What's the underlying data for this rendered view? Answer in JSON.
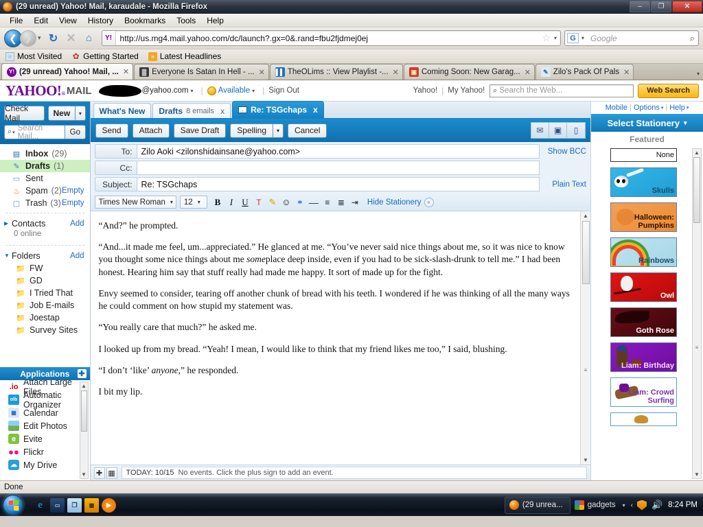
{
  "window": {
    "title": "(29 unread) Yahoo! Mail, karaudale - Mozilla Firefox",
    "firefox_icon": "firefox-icon",
    "minimize": "–",
    "maximize": "❐",
    "close": "✕"
  },
  "menubar": {
    "items": [
      "File",
      "Edit",
      "View",
      "History",
      "Bookmarks",
      "Tools",
      "Help"
    ]
  },
  "navbar": {
    "back_icon": "back-arrow-icon",
    "forward_icon": "forward-arrow-icon",
    "history_caret": "▾",
    "reload_icon": "↻",
    "stop_icon": "✕",
    "home_icon": "⌂",
    "favicon": "Y!",
    "url": "http://us.mg4.mail.yahoo.com/dc/launch?.gx=0&.rand=fbu2fjdmej0ej",
    "bookmark_star": "☆",
    "url_caret": "▾",
    "search_engine": "G",
    "search_engine_caret": "▾",
    "search_placeholder": "Google",
    "search_magnifier": "⌕"
  },
  "bookmarks": [
    {
      "label": "Most Visited",
      "icon": "most-visited-icon"
    },
    {
      "label": "Getting Started",
      "icon": "getting-started-icon"
    },
    {
      "label": "Latest Headlines",
      "icon": "rss-feed-icon"
    }
  ],
  "browser_tabs": [
    {
      "label": "(29 unread) Yahoo! Mail, ...",
      "favicon": "yahoo-favicon",
      "favicon_glyph": "Y!",
      "active": true,
      "close": "✕"
    },
    {
      "label": "Everyone Is Satan In Hell - ...",
      "favicon": "tv-favicon",
      "favicon_glyph": "▓",
      "active": false,
      "close": "✕"
    },
    {
      "label": "TheOLims :: View Playlist -...",
      "favicon": "playlist-favicon",
      "favicon_glyph": "▌▌",
      "active": false,
      "close": "✕"
    },
    {
      "label": "Coming Soon: New Garag...",
      "favicon": "garage-favicon",
      "favicon_glyph": "▣",
      "active": false,
      "close": "✕"
    },
    {
      "label": "Zilo's Pack Of Pals",
      "favicon": "pals-favicon",
      "favicon_glyph": "✎",
      "active": false,
      "close": "✕"
    }
  ],
  "tabstrip_overflow_caret": "▾",
  "yahoo_header": {
    "logo": "YAHOO!",
    "logo_reg": "®",
    "mail_word": "MAIL",
    "account_redacted": "redacted-username",
    "account_domain": "@yahoo.com",
    "account_caret": "▾",
    "status_icon": "smiley-icon",
    "status_label": "Available",
    "status_caret": "▾",
    "signout_label": "Sign Out",
    "nav_yahoo": "Yahoo!",
    "nav_myyahoo": "My Yahoo!",
    "web_search_placeholder": "Search the Web...",
    "web_search_magnifier": "⌕",
    "web_search_button": "Web Search"
  },
  "sidebar": {
    "check_mail_label": "Check Mail",
    "new_label": "New",
    "new_caret": "▾",
    "search_placeholder": "Search Mail...",
    "search_magnifier": "⌕",
    "search_caret": "▾",
    "go_label": "Go",
    "mail_folders": [
      {
        "label": "Inbox",
        "count": "(29)",
        "icon": "inbox-icon",
        "glyph": "▤",
        "action": "",
        "selected": false
      },
      {
        "label": "Drafts",
        "count": "(1)",
        "icon": "drafts-icon",
        "glyph": "✎",
        "action": "",
        "selected": true
      },
      {
        "label": "Sent",
        "count": "",
        "icon": "sent-icon",
        "glyph": "▭",
        "action": "",
        "selected": false
      },
      {
        "label": "Spam",
        "count": "(2)",
        "icon": "spam-flame-icon",
        "glyph": "🔥",
        "action": "Empty",
        "selected": false
      },
      {
        "label": "Trash",
        "count": "(3)",
        "icon": "trash-icon",
        "glyph": "🗑",
        "action": "Empty",
        "selected": false
      }
    ],
    "contacts": {
      "label": "Contacts",
      "add": "Add",
      "caret": "▶",
      "online": "0 online"
    },
    "folders": {
      "label": "Folders",
      "add": "Add",
      "caret": "▼"
    },
    "custom_folders": [
      {
        "label": "FW",
        "icon": "folder-icon"
      },
      {
        "label": "GD",
        "icon": "folder-icon"
      },
      {
        "label": "I Tried That",
        "icon": "folder-icon"
      },
      {
        "label": "Job E-mails",
        "icon": "folder-icon"
      },
      {
        "label": "Joestap",
        "icon": "folder-icon"
      },
      {
        "label": "Survey Sites",
        "icon": "folder-icon"
      }
    ],
    "applications": {
      "header": "Applications",
      "plus": "✚",
      "items": [
        {
          "label": "Attach Large Files",
          "icon": "io-icon",
          "glyph": ".io"
        },
        {
          "label": "Automatic Organizer",
          "icon": "olb-icon",
          "glyph": "olb"
        },
        {
          "label": "Calendar",
          "icon": "calendar-icon",
          "glyph": "▦"
        },
        {
          "label": "Edit Photos",
          "icon": "edit-photos-icon",
          "glyph": "▨"
        },
        {
          "label": "Evite",
          "icon": "evite-icon",
          "glyph": "e"
        },
        {
          "label": "Flickr",
          "icon": "flickr-icon",
          "glyph": "●●"
        },
        {
          "label": "My Drive",
          "icon": "my-drive-icon",
          "glyph": "☁"
        }
      ],
      "scroll_up": "▲",
      "scroll_down": "▼",
      "grip": "≡"
    }
  },
  "compose": {
    "tabs": [
      {
        "label": "What's New",
        "active": false,
        "closable": false
      },
      {
        "label": "Drafts",
        "sublabel": "8 emails",
        "active": false,
        "closable": true,
        "close": "x"
      },
      {
        "label": "Re: TSGchaps",
        "active": true,
        "closable": true,
        "close": "x",
        "icon": "envelope-icon"
      }
    ],
    "toolbar": {
      "send": "Send",
      "attach": "Attach",
      "save_draft": "Save Draft",
      "spelling": "Spelling",
      "spelling_caret": "▾",
      "cancel": "Cancel",
      "right_icons": [
        {
          "name": "email-notify-icon",
          "glyph": "✉"
        },
        {
          "name": "im-notify-icon",
          "glyph": "▣"
        },
        {
          "name": "mobile-text-icon",
          "glyph": "▯"
        }
      ]
    },
    "fields": {
      "to_label": "To:",
      "to_value": "Zilo Aoki <zilonshidainsane@yahoo.com>",
      "show_bcc": "Show BCC",
      "cc_label": "Cc:",
      "cc_value": "",
      "subject_label": "Subject:",
      "subject_value": "Re: TSGchaps",
      "plain_text": "Plain Text"
    },
    "format_toolbar": {
      "font_family": "Times New Roman",
      "font_size": "12",
      "caret": "▾",
      "bold": "B",
      "italic": "I",
      "underline": "U",
      "text_color_icon": "text-color-icon",
      "text_color_glyph": "T",
      "highlight_icon": "highlighter-icon",
      "highlight_glyph": "✎",
      "emoticon_icon": "emoticon-icon",
      "emoticon_glyph": "☺",
      "link_icon": "insert-link-icon",
      "link_glyph": "🔗",
      "hrule_icon": "horizontal-rule-icon",
      "hrule_glyph": "—",
      "align_icon": "align-icon",
      "align_glyph": "≡",
      "list_icon": "bullet-list-icon",
      "list_glyph": "⁝≡",
      "indent_icon": "indent-icon",
      "indent_glyph": "⇥",
      "hide_stationery": "Hide Stationery",
      "hide_stationery_glyph": "»"
    },
    "body_paragraphs": [
      {
        "text": "“And?” he prompted."
      },
      {
        "pre": "“And...it made me feel, um...appreciated.” He glanced at me. “You’ve never said nice things about me, so it was nice to know you thought some nice things about me ",
        "em": "some",
        "post": "place deep inside, even if you had to be sick-slash-drunk to tell me.” I had been honest. Hearing him say that stuff really had made me happy. It sort of made up for the fight."
      },
      {
        "text": "Envy seemed to consider, tearing off another chunk of bread with his teeth. I wondered if he was thinking of all the many ways he could comment on how stupid my statement was."
      },
      {
        "text": "“You really care that much?” he asked me."
      },
      {
        "text": "I looked up from my bread. “Yeah! I mean, I would like to think that my friend likes me too,” I said, blushing."
      },
      {
        "pre": "“I don’t ‘like’ ",
        "em": "anyone",
        "post": ",” he responded."
      },
      {
        "text": "I bit my lip."
      }
    ],
    "body_scroll": {
      "up": "▲",
      "down": "▼",
      "grip": "≡"
    },
    "calendar_bar": {
      "plus": "✚",
      "cal_icon": "calendar-grid-icon",
      "cal_glyph": "▦",
      "today_label": "TODAY: 10/15",
      "text": "No events. Click the plus sign to add an event."
    }
  },
  "stationery": {
    "top_links": {
      "mobile": "Mobile",
      "options": "Options",
      "options_caret": "▾",
      "help": "Help",
      "help_caret": "▾"
    },
    "header": "Select Stationery",
    "header_caret": "▾",
    "section": "Featured",
    "items": [
      {
        "label": "None",
        "kind": "none"
      },
      {
        "label": "Skulls",
        "kind": "skulls"
      },
      {
        "label": "Halloween: Pumpkins",
        "kind": "halloween"
      },
      {
        "label": "Rainbows",
        "kind": "rainbows"
      },
      {
        "label": "Owl",
        "kind": "owl"
      },
      {
        "label": "Goth Rose",
        "kind": "goth"
      },
      {
        "label": "Liam: Birthday",
        "kind": "liam"
      },
      {
        "label": "Liam: Crowd Surfing",
        "kind": "crowd"
      },
      {
        "label": "",
        "kind": "last"
      }
    ],
    "scroll": {
      "up": "▲",
      "down": "▼",
      "grip": "≡"
    }
  },
  "status_bar": {
    "text": "Done"
  },
  "taskbar": {
    "start_icon": "windows-start-orb",
    "quick_launch": [
      {
        "name": "internet-explorer-icon",
        "glyph": "e"
      },
      {
        "name": "show-desktop-icon",
        "glyph": "▭"
      },
      {
        "name": "switch-windows-icon",
        "glyph": "❐"
      },
      {
        "name": "media-app-icon",
        "glyph": "▩"
      },
      {
        "name": "windows-media-player-icon",
        "glyph": "▶"
      }
    ],
    "windows": [
      {
        "label": "(29 unrea...",
        "icon": "firefox-icon"
      }
    ],
    "tray": {
      "gadgets_label": "gadgets",
      "gadgets_icon": "gadgets-icon",
      "caret": "▾",
      "left_arrow": "‹",
      "shield_icon": "security-shield-icon",
      "speaker_icon": "🔊",
      "clock": "8:24 PM"
    }
  },
  "colors": {
    "yahoo_purple": "#6b0f8f",
    "accent_blue": "#1581c4",
    "link_blue": "#1a6bbd",
    "selected_green": "#cdf0c0",
    "gold": "#fcb415"
  }
}
